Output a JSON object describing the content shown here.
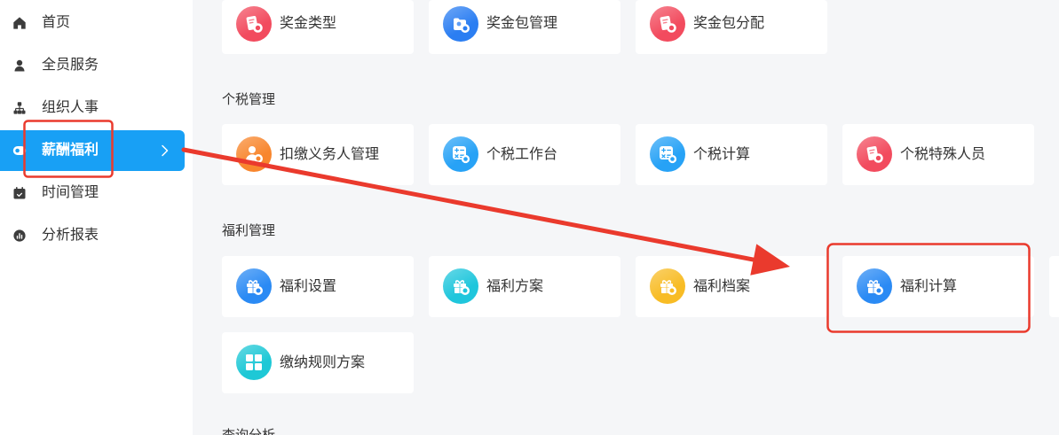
{
  "sidebar": {
    "items": [
      {
        "label": "首页",
        "icon": "home-icon"
      },
      {
        "label": "全员服务",
        "icon": "user-icon"
      },
      {
        "label": "组织人事",
        "icon": "org-chart-icon"
      },
      {
        "label": "薪酬福利",
        "icon": "salary-icon",
        "active": true,
        "trailing_icon": "chevron-right-icon"
      },
      {
        "label": "时间管理",
        "icon": "calendar-icon"
      },
      {
        "label": "分析报表",
        "icon": "chart-icon"
      }
    ]
  },
  "bonus_section": {
    "cards": [
      {
        "label": "奖金类型",
        "icon": "bonus-type-icon",
        "color": "#f24b5e"
      },
      {
        "label": "奖金包管理",
        "icon": "bonus-package-icon",
        "color": "#2b7ef2"
      },
      {
        "label": "奖金包分配",
        "icon": "bonus-allocation-icon",
        "color": "#f24b5e"
      }
    ]
  },
  "tax_section": {
    "title": "个税管理",
    "cards": [
      {
        "label": "扣缴义务人管理",
        "icon": "withholding-agent-icon",
        "color": "#f8862d"
      },
      {
        "label": "个税工作台",
        "icon": "tax-workbench-icon",
        "color": "#27a2f6"
      },
      {
        "label": "个税计算",
        "icon": "tax-calculation-icon",
        "color": "#27a2f6"
      },
      {
        "label": "个税特殊人员",
        "icon": "tax-special-staff-icon",
        "color": "#f24b5e"
      }
    ]
  },
  "welfare_section": {
    "title": "福利管理",
    "cards": [
      {
        "label": "福利设置",
        "icon": "welfare-settings-icon",
        "color": "#2a8af4"
      },
      {
        "label": "福利方案",
        "icon": "welfare-plan-icon",
        "color": "#1fc6dc"
      },
      {
        "label": "福利档案",
        "icon": "welfare-archive-icon",
        "color": "#f8bc25"
      },
      {
        "label": "福利计算",
        "icon": "welfare-calculation-icon",
        "color": "#2a8af4"
      },
      {
        "label": "缴纳规则方案",
        "icon": "payment-rule-plan-icon",
        "color": "#1ec8d6"
      }
    ]
  },
  "query_section": {
    "title": "查询分析"
  },
  "theme": {
    "page_bg": "#f5f6f8",
    "active_nav_bg": "#18a0f5",
    "annotation_color": "#ea3a2d"
  }
}
